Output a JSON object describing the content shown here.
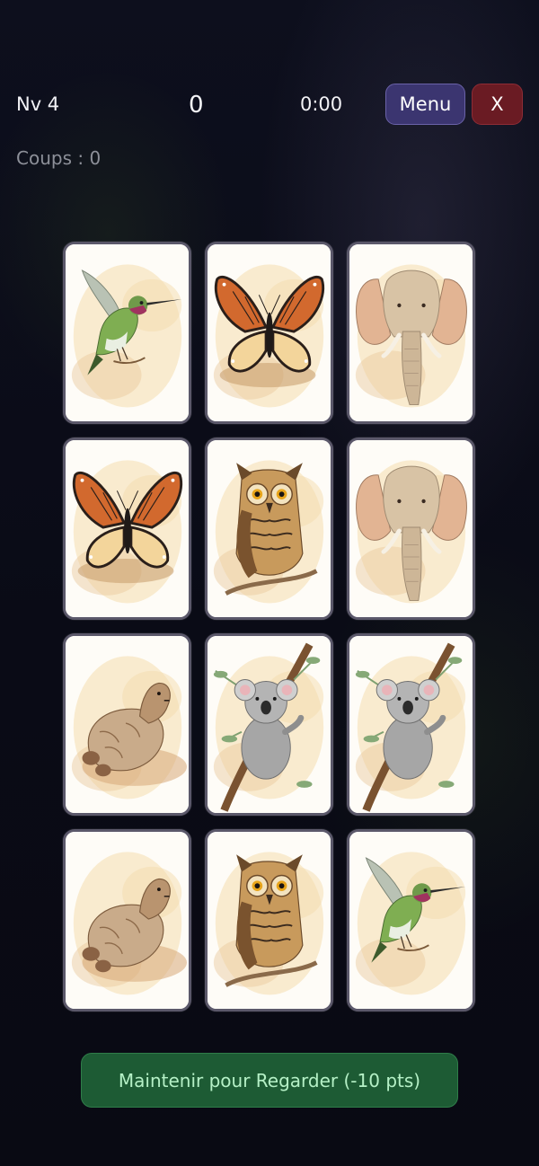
{
  "hud": {
    "level": "Nv 4",
    "score": "0",
    "timer": "0:00",
    "menu_label": "Menu",
    "close_label": "X",
    "moves": "Coups : 0"
  },
  "board": {
    "rows": 4,
    "columns": 3,
    "cards": [
      {
        "animal": "hummingbird"
      },
      {
        "animal": "butterfly"
      },
      {
        "animal": "elephant"
      },
      {
        "animal": "butterfly"
      },
      {
        "animal": "owl"
      },
      {
        "animal": "elephant"
      },
      {
        "animal": "otter"
      },
      {
        "animal": "koala"
      },
      {
        "animal": "koala"
      },
      {
        "animal": "otter"
      },
      {
        "animal": "owl"
      },
      {
        "animal": "hummingbird"
      }
    ]
  },
  "actions": {
    "peek_label": "Maintenir pour Regarder (-10 pts)"
  },
  "colors": {
    "background": "#0b0c17",
    "menu_button": "#3b3570",
    "close_button": "#6a1b23",
    "peek_button": "#1d5b34",
    "peek_text": "#b5f0c6",
    "card_border": "#5b586a",
    "moves_text": "#8d9099"
  }
}
